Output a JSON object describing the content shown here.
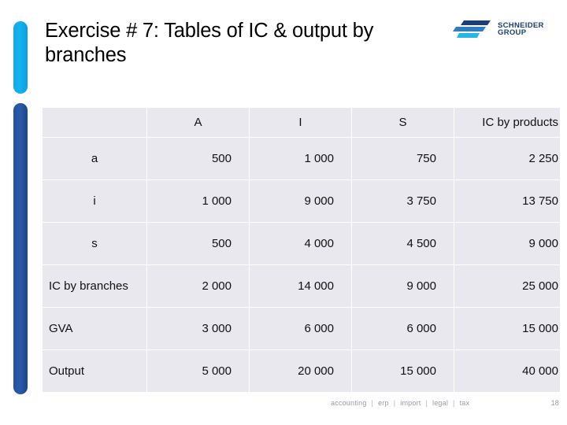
{
  "slide": {
    "title": "Exercise # 7: Tables of IC & output by branches"
  },
  "logo": {
    "line1": "SCHNEIDER",
    "line2": "GROUP",
    "mark_icon": "three-bars-logo-icon",
    "colors": {
      "navy": "#1b3f74",
      "mid_blue": "#2e7cc4",
      "cyan": "#27b4e6"
    }
  },
  "table": {
    "columns": [
      "",
      "A",
      "I",
      "S",
      "IC by products"
    ],
    "rows": [
      {
        "label": "a",
        "align": "center",
        "values": [
          "500",
          "1 000",
          "750",
          "2 250"
        ]
      },
      {
        "label": "i",
        "align": "center",
        "values": [
          "1 000",
          "9 000",
          "3 750",
          "13 750"
        ]
      },
      {
        "label": "s",
        "align": "center",
        "values": [
          "500",
          "4 000",
          "4 500",
          "9 000"
        ]
      },
      {
        "label": "IC by branches",
        "align": "left",
        "values": [
          "2 000",
          "14 000",
          "9 000",
          "25 000"
        ]
      },
      {
        "label": "GVA",
        "align": "left",
        "values": [
          "3 000",
          "6 000",
          "6 000",
          "15 000"
        ]
      },
      {
        "label": "Output",
        "align": "left",
        "values": [
          "5 000",
          "20 000",
          "15 000",
          "40 000"
        ]
      }
    ]
  },
  "footer": {
    "items": [
      "accounting",
      "erp",
      "import",
      "legal",
      "tax"
    ],
    "separator": "|",
    "page_number": "18"
  },
  "theme": {
    "rail_cyan": "#12b3ee",
    "rail_navy": "#23519c",
    "table_bg": "#e8e8ee",
    "grid_line": "#ffffff"
  }
}
